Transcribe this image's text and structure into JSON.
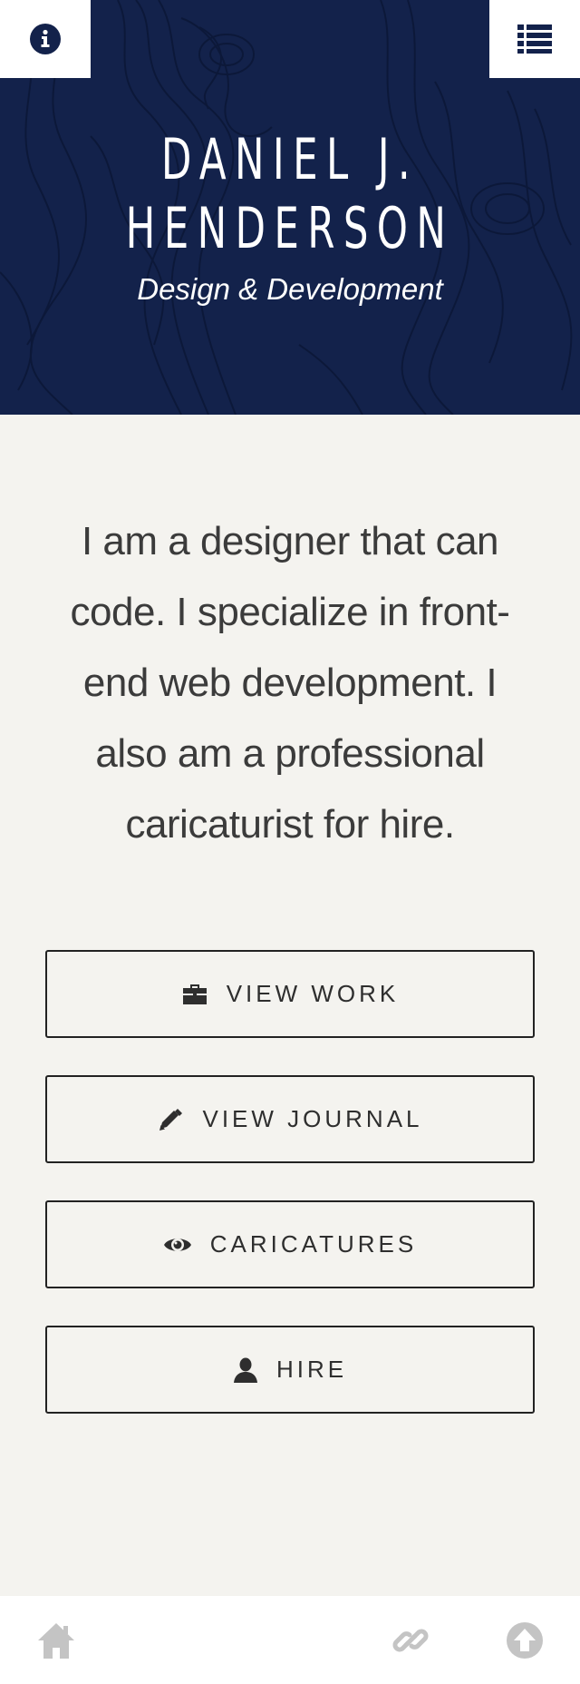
{
  "header": {
    "title_line1": "DANIEL J.",
    "title_line2": "HENDERSON",
    "subtitle": "Design & Development",
    "left_button_icon": "info-icon",
    "right_button_icon": "list-icon",
    "background_color": "#13224b"
  },
  "intro": {
    "text": "I am a designer that can code. I specialize in front-end web development. I also am a professional caricaturist for hire."
  },
  "buttons": [
    {
      "label": "VIEW WORK",
      "icon": "briefcase-icon"
    },
    {
      "label": "VIEW JOURNAL",
      "icon": "pencil-icon"
    },
    {
      "label": "CARICATURES",
      "icon": "eye-icon"
    },
    {
      "label": "HIRE",
      "icon": "user-icon"
    }
  ],
  "footer": {
    "icons": [
      "home-icon",
      "link-icon",
      "arrow-up-icon"
    ]
  }
}
